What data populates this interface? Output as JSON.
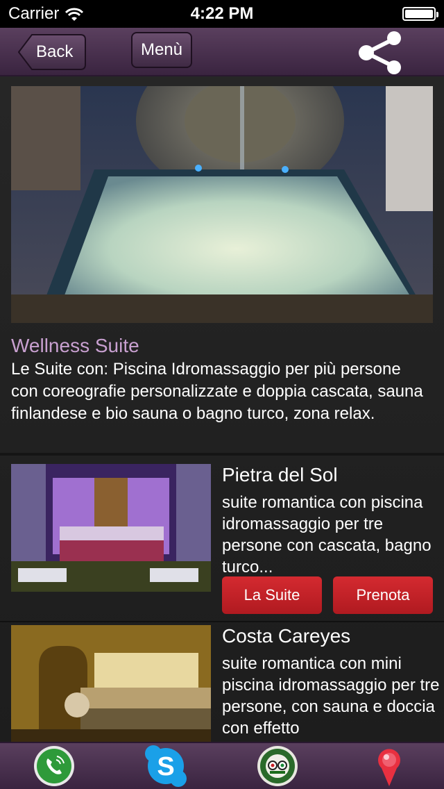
{
  "status": {
    "carrier": "Carrier",
    "time": "4:22 PM"
  },
  "nav": {
    "back_label": "Back",
    "menu_label": "Menù",
    "share_icon": "share-icon"
  },
  "featured": {
    "title": "Wellness Suite",
    "description": "Le Suite con: Piscina Idromassaggio per più persone con coreografie personalizzate e doppia cascata, sauna finlandese e bio sauna o bagno turco, zona relax."
  },
  "items": [
    {
      "title": "Pietra del Sol",
      "description": "suite romantica con piscina idromassaggio per tre persone con cascata, bagno turco...",
      "suite_label": "La Suite",
      "book_label": "Prenota"
    },
    {
      "title": "Costa Careyes",
      "description": "suite romantica con mini piscina idromassaggio per tre persone, con sauna e doccia con effetto"
    }
  ],
  "tab_bar": {
    "icons": [
      "phone-icon",
      "skype-icon",
      "tripadvisor-icon",
      "map-pin-icon"
    ],
    "skype_letter": "S"
  },
  "colors": {
    "accent_title": "#c8a0d0",
    "button_red": "#c82228",
    "nav_purple": "#4a3250"
  }
}
